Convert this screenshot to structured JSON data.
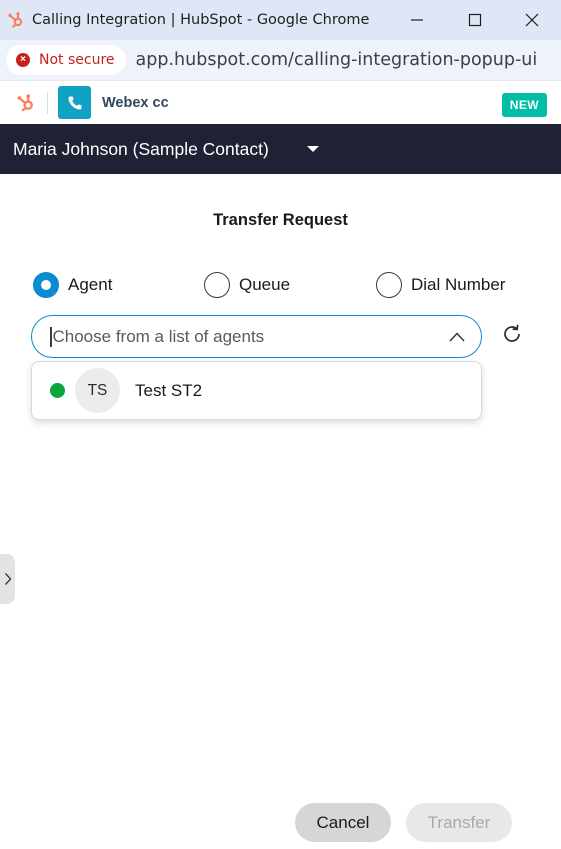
{
  "window": {
    "title": "Calling Integration | HubSpot - Google Chrome",
    "minimize_icon": "minimize-icon",
    "maximize_icon": "maximize-icon",
    "close_icon": "close-icon"
  },
  "address_bar": {
    "security_label": "Not secure",
    "security_color": "#c5221f",
    "url": "app.hubspot.com/calling-integration-popup-ui/4..."
  },
  "app_header": {
    "app_name": "Webex cc",
    "badge": "NEW",
    "badge_color": "#00bda5",
    "tile_color": "#11a1c2"
  },
  "contact": {
    "name": "Maria Johnson (Sample Contact)",
    "bar_color": "#1f2134"
  },
  "transfer": {
    "title": "Transfer Request",
    "options": [
      {
        "label": "Agent",
        "checked": true
      },
      {
        "label": "Queue",
        "checked": false
      },
      {
        "label": "Dial Number",
        "checked": false
      }
    ],
    "search_placeholder": "Choose from a list of agents",
    "agents": [
      {
        "initials": "TS",
        "name": "Test ST2",
        "status": "available",
        "status_color": "#08a73b"
      }
    ],
    "accent_color": "#0b8bd1"
  },
  "actions": {
    "cancel_label": "Cancel",
    "transfer_label": "Transfer",
    "transfer_enabled": false
  }
}
